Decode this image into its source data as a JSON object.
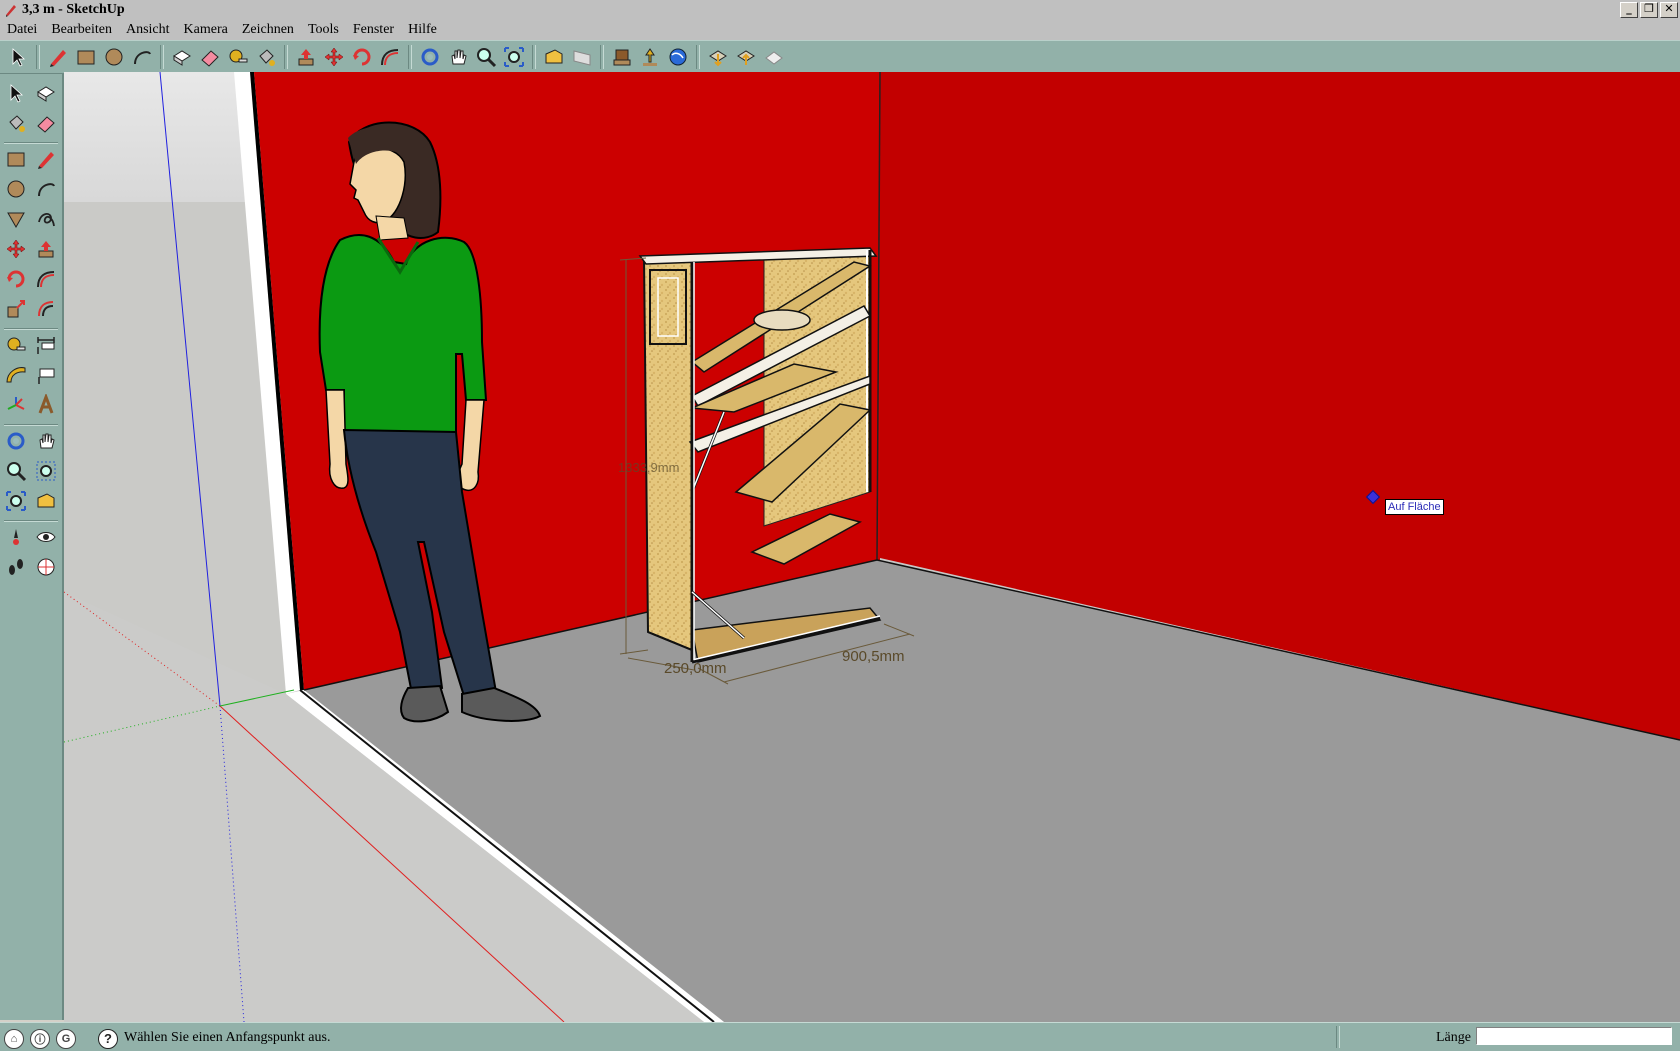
{
  "window": {
    "title": "3,3 m - SketchUp",
    "controls": [
      "_",
      "❐",
      "✕"
    ]
  },
  "menu": [
    "Datei",
    "Bearbeiten",
    "Ansicht",
    "Kamera",
    "Zeichnen",
    "Tools",
    "Fenster",
    "Hilfe"
  ],
  "toolbar": {
    "groups": [
      [
        "select-icon"
      ],
      [
        "pencil-icon",
        "rectangle-icon",
        "circle-icon",
        "arc-icon"
      ],
      [
        "make-component-icon",
        "eraser-icon",
        "tape-measure-icon",
        "paint-bucket-icon"
      ],
      [
        "push-pull-icon",
        "move-icon",
        "rotate-icon",
        "follow-me-icon"
      ],
      [
        "orbit-icon",
        "pan-icon",
        "zoom-icon",
        "zoom-extents-icon"
      ],
      [
        "previous-view-icon",
        "next-view-icon"
      ],
      [
        "get-models-icon",
        "share-model-icon",
        "google-earth-icon"
      ],
      [
        "get-current-view-icon",
        "toggle-terrain-icon",
        "place-model-icon"
      ]
    ]
  },
  "left_tools": [
    [
      "select-icon",
      "make-component-icon"
    ],
    [
      "paint-bucket-icon",
      "eraser-icon"
    ],
    [
      "rectangle-icon",
      "pencil-icon"
    ],
    [
      "circle-icon",
      "arc-icon"
    ],
    [
      "polygon-icon",
      "freehand-icon"
    ],
    [
      "move-icon",
      "push-pull-icon"
    ],
    [
      "rotate-icon",
      "follow-me-icon"
    ],
    [
      "scale-icon",
      "offset-icon"
    ],
    [
      "tape-measure-icon",
      "dimension-icon"
    ],
    [
      "protractor-icon",
      "text-icon"
    ],
    [
      "axes-icon",
      "3d-text-icon"
    ],
    [
      "orbit-icon",
      "pan-icon"
    ],
    [
      "zoom-icon",
      "zoom-window-icon"
    ],
    [
      "zoom-extents-icon",
      "previous-view-icon"
    ],
    [
      "position-camera-icon",
      "look-around-icon"
    ],
    [
      "walk-icon",
      "section-plane-icon"
    ]
  ],
  "viewport": {
    "inference_tooltip": "Auf Fläche",
    "dimensions": {
      "height": "1333,9mm",
      "depth": "250,0mm",
      "width": "900,5mm"
    }
  },
  "status": {
    "message": "Wählen Sie einen Anfangspunkt aus.",
    "vcb_label": "Länge",
    "vcb_value": ""
  }
}
